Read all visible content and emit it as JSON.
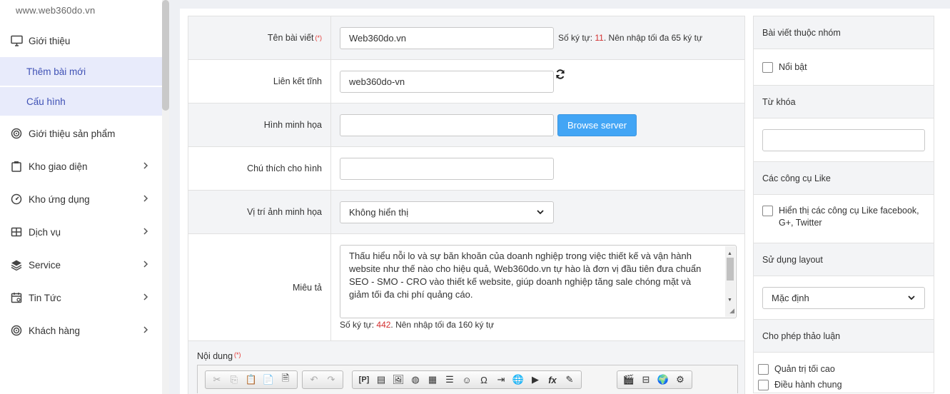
{
  "sidebar": {
    "site_url": "www.web360do.vn",
    "items": [
      {
        "label": "Giới thiệu",
        "icon": "monitor-icon",
        "has_chevron": false
      },
      {
        "label": "Thêm bài mới",
        "sub": true
      },
      {
        "label": "Cấu hình",
        "sub": true
      },
      {
        "label": "Giới thiệu sản phẩm",
        "icon": "target-icon",
        "has_chevron": false
      },
      {
        "label": "Kho giao diện",
        "icon": "clipboard-icon",
        "has_chevron": true
      },
      {
        "label": "Kho ứng dụng",
        "icon": "gauge-icon",
        "has_chevron": true
      },
      {
        "label": "Dịch vụ",
        "icon": "grid-icon",
        "has_chevron": true
      },
      {
        "label": "Service",
        "icon": "layers-icon",
        "has_chevron": true
      },
      {
        "label": "Tin Tức",
        "icon": "calendar-icon",
        "has_chevron": true
      },
      {
        "label": "Khách hàng",
        "icon": "target-icon",
        "has_chevron": true
      }
    ]
  },
  "form": {
    "title_label": "Tên bài viết",
    "required_mark": "(*)",
    "title_value": "Web360do.vn",
    "title_hint_prefix": "Số ký tự: ",
    "title_hint_count": "11",
    "title_hint_suffix": ". Nên nhập tối đa 65 ký tự",
    "slug_label": "Liên kết tĩnh",
    "slug_value": "web360do-vn",
    "image_label": "Hình minh họa",
    "image_value": "",
    "browse_label": "Browse server",
    "caption_label": "Chú thích cho hình",
    "caption_value": "",
    "position_label": "Vị trí ảnh minh họa",
    "position_value": "Không hiển thị",
    "desc_label": "Miêu tả",
    "desc_value": "Thấu hiểu nỗi lo và sự băn khoăn của doanh nghiệp trong việc thiết kế và vận hành website như thế nào cho hiệu quả, Web360do.vn tự hào là đơn vị đầu tiên đưa chuẩn SEO - SMO - CRO vào thiết kế website, giúp doanh nghiệp tăng sale chóng mặt và giảm tối đa chi phí quảng cáo.",
    "desc_hint_prefix": "Số ký tự: ",
    "desc_hint_count": "442",
    "desc_hint_suffix": ". Nên nhập tối đa 160 ký tự",
    "content_label": "Nội dung"
  },
  "side": {
    "group_title": "Bài viết thuộc nhóm",
    "featured_label": "Nổi bật",
    "keywords_title": "Từ khóa",
    "keywords_value": "",
    "like_title": "Các công cụ Like",
    "like_label": "Hiển thị các công cụ Like facebook, G+, Twitter",
    "layout_title": "Sử dụng layout",
    "layout_value": "Mặc định",
    "discuss_title": "Cho phép thảo luận",
    "discuss_options": [
      "Quản trị tối cao",
      "Điều hành chung"
    ]
  },
  "colors": {
    "accent": "#3f51b5",
    "sub_bg": "#e8ebfb",
    "browse_button": "#42a5f5",
    "required": "#e53935"
  }
}
